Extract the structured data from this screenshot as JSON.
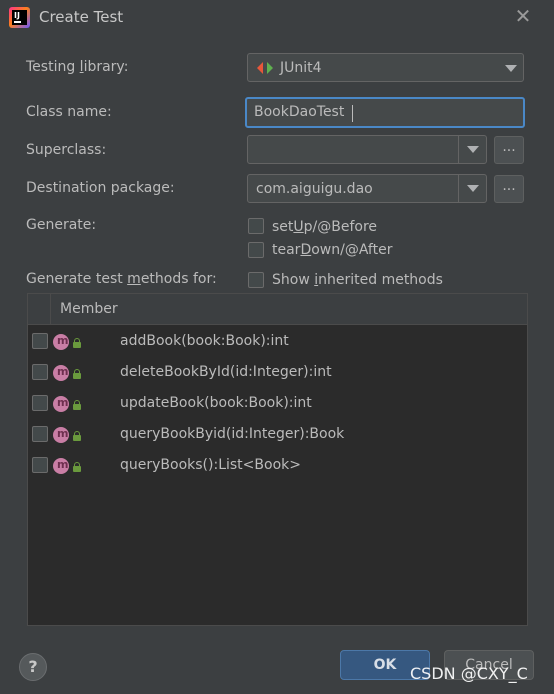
{
  "window": {
    "title": "Create Test",
    "close_icon": "close-icon",
    "app_icon": "intellij-icon"
  },
  "form": {
    "testing_library": {
      "label_pre": "Testing ",
      "label_mn": "l",
      "label_post": "ibrary:",
      "value": "JUnit4"
    },
    "class_name": {
      "label": "Class name:",
      "value": "BookDaoTest"
    },
    "superclass": {
      "label": "Superclass:",
      "value": "",
      "browse": "..."
    },
    "destination_package": {
      "label": "Destination package:",
      "value": "com.aiguigu.dao",
      "browse": "..."
    },
    "generate": {
      "label": "Generate:",
      "setup": {
        "pre": "set",
        "mn": "U",
        "post": "p/@Before",
        "checked": false
      },
      "teardown": {
        "pre": "tear",
        "mn": "D",
        "post": "own/@After",
        "checked": false
      }
    },
    "methods_for": {
      "label_pre": "Generate test ",
      "label_mn": "m",
      "label_post": "ethods for:"
    },
    "show_inherited": {
      "pre": "Show ",
      "mn": "i",
      "post": "nherited methods",
      "checked": false
    }
  },
  "table": {
    "header": "Member",
    "rows": [
      {
        "text": "addBook(book:Book):int",
        "checked": false
      },
      {
        "text": "deleteBookById(id:Integer):int",
        "checked": false
      },
      {
        "text": "updateBook(book:Book):int",
        "checked": false
      },
      {
        "text": "queryBookByid(id:Integer):Book",
        "checked": false
      },
      {
        "text": "queryBooks():List<Book>",
        "checked": false
      }
    ]
  },
  "footer": {
    "help": "?",
    "ok": "OK",
    "cancel": "Cancel"
  },
  "watermark": "CSDN @CXY_C",
  "colors": {
    "background": "#3c3f41",
    "accent": "#4a88c7",
    "ok_button": "#365880",
    "method_icon": "#c97ea5",
    "lock_icon": "#6a9a3d"
  }
}
